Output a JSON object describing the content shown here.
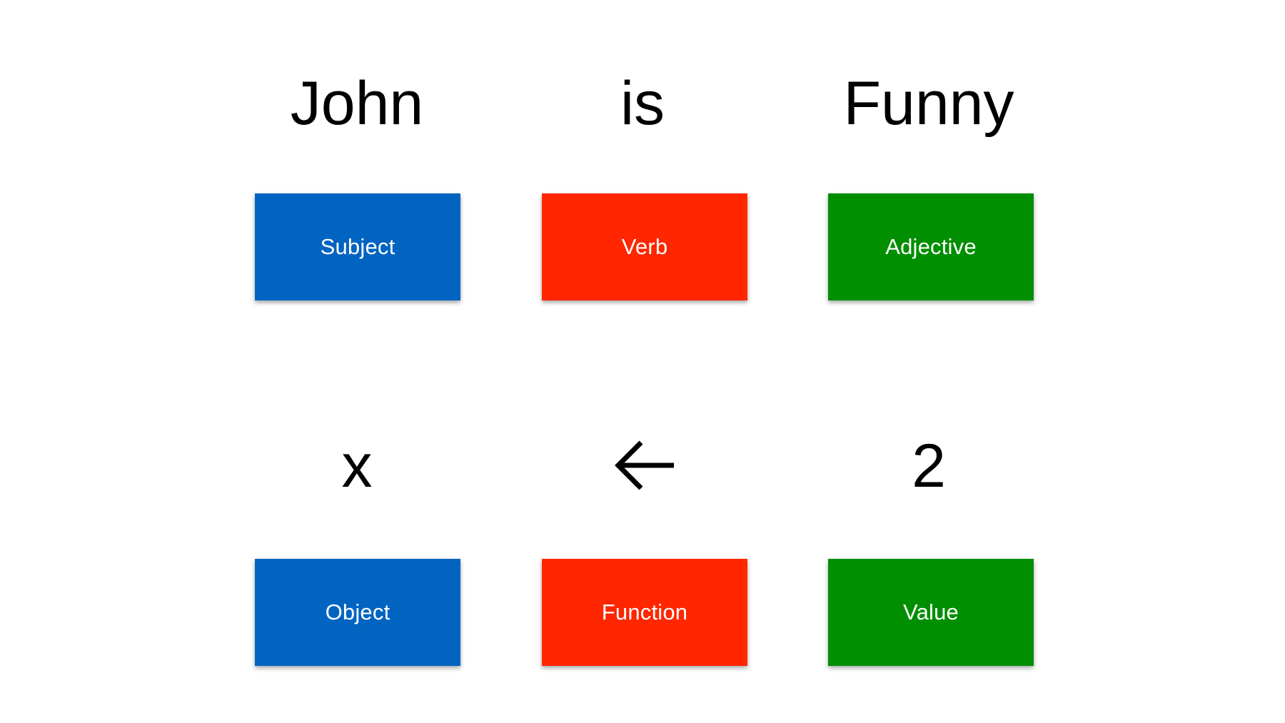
{
  "colors": {
    "blue": "#0264C1",
    "red": "#FF2600",
    "green": "#008F00",
    "text": "#000000",
    "background": "#FFFFFF"
  },
  "row1": {
    "words": [
      "John",
      "is",
      "Funny"
    ],
    "labels": [
      "Subject",
      "Verb",
      "Adjective"
    ]
  },
  "row2": {
    "words": [
      "x",
      "",
      "2"
    ],
    "arrow_icon": "left-arrow-icon",
    "labels": [
      "Object",
      "Function",
      "Value"
    ]
  }
}
